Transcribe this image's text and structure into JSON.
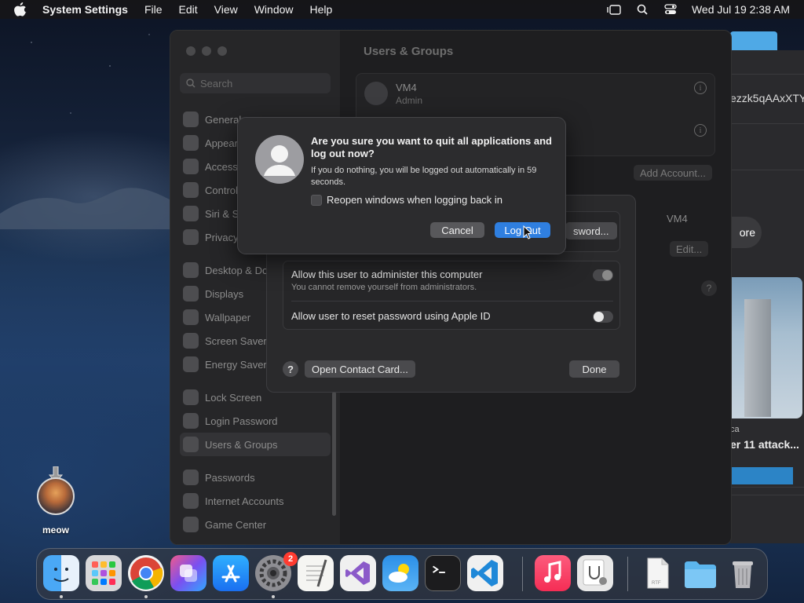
{
  "menubar": {
    "app_name": "System Settings",
    "menus": [
      "File",
      "Edit",
      "View",
      "Window",
      "Help"
    ],
    "clock": "Wed Jul 19  2:38 AM"
  },
  "settings_window": {
    "search_placeholder": "Search",
    "title": "Users & Groups",
    "sidebar_items": [
      {
        "label": "General"
      },
      {
        "label": "Appearance"
      },
      {
        "label": "Accessibility"
      },
      {
        "label": "Control Centre"
      },
      {
        "label": "Siri & Spotlight"
      },
      {
        "label": "Privacy & Security"
      },
      {
        "label": "Desktop & Dock"
      },
      {
        "label": "Displays"
      },
      {
        "label": "Wallpaper"
      },
      {
        "label": "Screen Saver"
      },
      {
        "label": "Energy Saver"
      },
      {
        "label": "Lock Screen"
      },
      {
        "label": "Login Password"
      },
      {
        "label": "Users & Groups"
      },
      {
        "label": "Passwords"
      },
      {
        "label": "Internet Accounts"
      },
      {
        "label": "Game Center"
      }
    ],
    "user": {
      "name": "VM4",
      "role": "Admin"
    },
    "add_account_label": "Add Account...",
    "auto_login_value": "VM4",
    "edit_label": "Edit..."
  },
  "user_sheet": {
    "password_button": "Change Password...",
    "password_button_visible": "sword...",
    "admin_toggle_label": "Allow this user to administer this computer",
    "admin_toggle_sub": "You cannot remove yourself from administrators.",
    "reset_toggle_label": "Allow user to reset password using Apple ID",
    "help_label": "?",
    "contact_card_label": "Open Contact Card...",
    "done_label": "Done"
  },
  "alert": {
    "title": "Are you sure you want to quit all applications and log out now?",
    "message": "If you do nothing, you will be logged out automatically in 59 seconds.",
    "checkbox_label": "Reopen windows when logging back in",
    "cancel_label": "Cancel",
    "logout_label": "Log Out"
  },
  "background_window": {
    "hash_text": "ezzk5qAAxXTY",
    "more_label": "ore",
    "caption_small": "ca",
    "caption_title": "er 11 attack..."
  },
  "desktop_icon": {
    "label": "meow"
  },
  "dock": {
    "apps": [
      "Finder",
      "Launchpad",
      "Google Chrome",
      "Shortcuts",
      "App Store",
      "System Settings",
      "TextEdit",
      "Visual Studio",
      "Weather",
      "Terminal",
      "Visual Studio Code",
      "Music",
      "Preview",
      "Document",
      "Folder",
      "Trash"
    ],
    "system_settings_badge": "2"
  },
  "colors": {
    "accent": "#2f7fe0",
    "badge": "#ff3b30"
  }
}
